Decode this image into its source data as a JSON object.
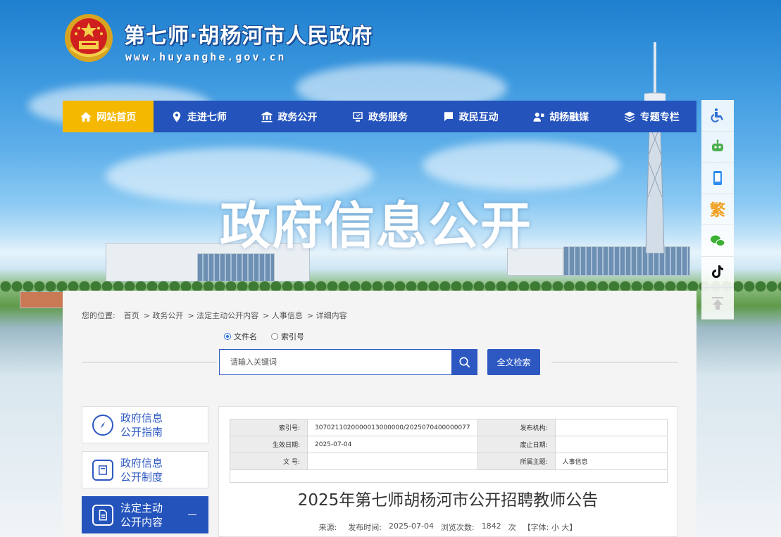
{
  "header": {
    "site_title": "第七师·胡杨河市人民政府",
    "site_url": "www.huyanghe.gov.cn",
    "hero_title": "政府信息公开"
  },
  "nav": [
    {
      "label": "网站首页",
      "icon": "home-icon",
      "active": true
    },
    {
      "label": "走进七师",
      "icon": "location-icon"
    },
    {
      "label": "政务公开",
      "icon": "building-icon"
    },
    {
      "label": "政务服务",
      "icon": "service-icon"
    },
    {
      "label": "政民互动",
      "icon": "chat-icon"
    },
    {
      "label": "胡杨融媒",
      "icon": "media-icon"
    },
    {
      "label": "专题专栏",
      "icon": "layers-icon"
    }
  ],
  "toolbar": {
    "icons": [
      "accessibility-icon",
      "robot-icon",
      "mobile-icon",
      "traditional-chinese-icon",
      "wechat-icon",
      "tiktok-icon",
      "back-to-top-icon"
    ],
    "fan_label": "繁"
  },
  "breadcrumb": {
    "prefix": "您的位置:",
    "items": [
      "首页",
      "> 政务公开",
      "> 法定主动公开内容",
      "> 人事信息",
      "> 详细内容"
    ]
  },
  "search": {
    "radio_options": [
      "文件名",
      "索引号"
    ],
    "selected": "文件名",
    "placeholder": "请输入关键词",
    "full_search_label": "全文检索"
  },
  "sidebar": [
    {
      "line1": "政府信息",
      "line2": "公开指南",
      "icon": "compass-icon"
    },
    {
      "line1": "政府信息",
      "line2": "公开制度",
      "icon": "book-icon"
    },
    {
      "line1": "法定主动",
      "line2": "公开内容",
      "icon": "document-icon",
      "active": true
    }
  ],
  "meta": {
    "index_label": "索引号:",
    "index_value": "3070211020000013000000/2025070400000077",
    "publisher_label": "发布机构:",
    "publisher_value": "",
    "effective_label": "生效日期:",
    "effective_value": "2025-07-04",
    "expire_label": "废止日期:",
    "expire_value": "",
    "docno_label": "文 号:",
    "docno_value": "",
    "topic_label": "所属主题:",
    "topic_value": "人事信息"
  },
  "article": {
    "title": "2025年第七师胡杨河市公开招聘教师公告",
    "source_label": "来源:",
    "published_label": "发布时间:",
    "published_value": "2025-07-04",
    "views_label": "浏览次数:",
    "views_value": "1842",
    "views_unit": "次",
    "font_label": "【字体: 小 大】"
  },
  "colors": {
    "nav_blue": "#2453bc",
    "nav_active": "#f5b800",
    "accent_blue": "#2d58c2"
  }
}
